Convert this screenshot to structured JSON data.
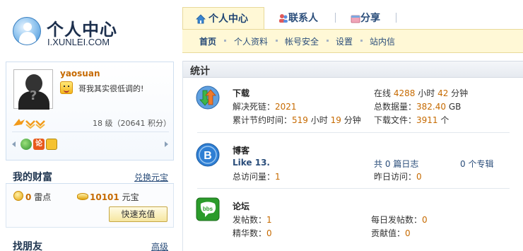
{
  "logo": {
    "title": "个人中心",
    "subtitle": "I.XUNLEI.COM"
  },
  "tabs": [
    {
      "label": "个人中心",
      "icon": "home-icon"
    },
    {
      "label": "联系人",
      "icon": "contacts-icon"
    },
    {
      "label": "分享",
      "icon": "share-icon"
    }
  ],
  "subnav": [
    "首页",
    "个人资料",
    "帐号安全",
    "设置",
    "站内信"
  ],
  "profile": {
    "username": "yaosuan",
    "mood": "哥我其实很低调的!",
    "level_text": "18 级（20641 积分）"
  },
  "wealth": {
    "title": "我的财富",
    "exchange_link": "兑换元宝",
    "thunder_points": "0",
    "thunder_unit": "雷点",
    "yuanbao": "10101",
    "yuanbao_unit": "元宝",
    "recharge_button": "快速充值"
  },
  "friends": {
    "title": "找朋友",
    "advanced_link": "高级"
  },
  "stats": {
    "title": "统计",
    "download": {
      "title": "下载",
      "deadlink_label": "解决死链：",
      "deadlink_value": "2021",
      "saved_label": "累计节约时间：",
      "saved_hours": "519",
      "hours_unit": "小时",
      "saved_minutes": "19",
      "minutes_unit": "分钟",
      "online_label": "在线",
      "online_hours": "4288",
      "online_minutes": "42",
      "total_label": "总数据量：",
      "total_value": "382.40",
      "total_unit": "GB",
      "files_label": "下载文件：",
      "files_value": "3911",
      "files_unit": "个"
    },
    "blog": {
      "title": "博客",
      "name": "Like 13.",
      "visits_label": "总访问量：",
      "visits_value": "1",
      "logs_prefix": "共",
      "logs_value": "0",
      "logs_suffix": "篇日志",
      "topics": "0 个专辑",
      "yesterday_label": "昨日访问：",
      "yesterday_value": "0"
    },
    "forum": {
      "title": "论坛",
      "posts_label": "发帖数：",
      "posts_value": "1",
      "essence_label": "精华数：",
      "essence_value": "0",
      "daily_label": "每日发帖数：",
      "daily_value": "0",
      "contrib_label": "贡献值：",
      "contrib_value": "0"
    }
  },
  "colors": {
    "accent_orange": "#c66a00",
    "link_blue": "#2a4d7a",
    "tab_bg": "#fff8d6"
  }
}
